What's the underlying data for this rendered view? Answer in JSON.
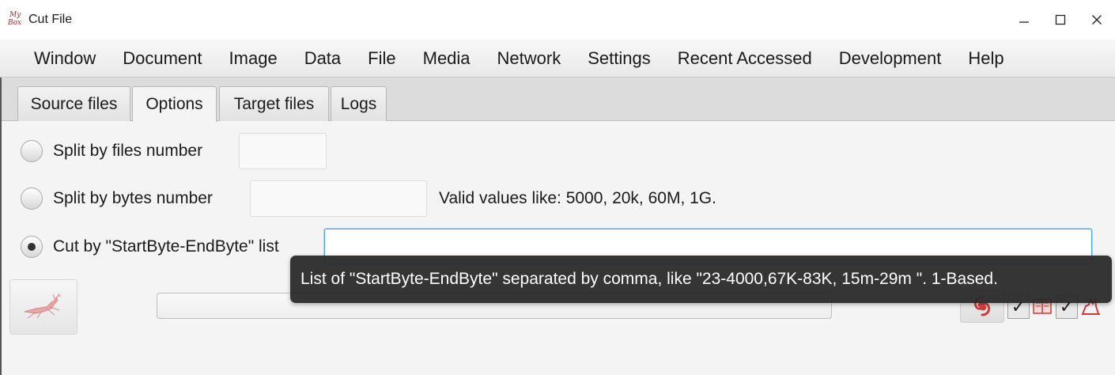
{
  "window": {
    "title": "Cut File",
    "logo_top": "My",
    "logo_bottom": "Box"
  },
  "menu": [
    "Window",
    "Document",
    "Image",
    "Data",
    "File",
    "Media",
    "Network",
    "Settings",
    "Recent Accessed",
    "Development",
    "Help"
  ],
  "tabs": [
    {
      "label": "Source files",
      "active": false
    },
    {
      "label": "Options",
      "active": true
    },
    {
      "label": "Target files",
      "active": false
    },
    {
      "label": "Logs",
      "active": false
    }
  ],
  "options": {
    "split_files": {
      "label": "Split by files number",
      "value": "",
      "selected": false
    },
    "split_bytes": {
      "label": "Split by bytes number",
      "value": "",
      "selected": false,
      "hint": "Valid values like: 5000, 20k, 60M, 1G."
    },
    "cut_list": {
      "label": "Cut by \"StartByte-EndByte\" list",
      "value": "",
      "selected": true
    }
  },
  "tooltip": "List of \"StartByte-EndByte\" separated by comma, like \"23-4000,67K-83K, 15m-29m \". 1-Based.",
  "progress": 0,
  "icons": {
    "start": "running-deer-icon",
    "tool": "netease-logo-icon",
    "book": "book-icon",
    "cat": "cat-icon"
  },
  "colors": {
    "accent_red": "#d23b3b",
    "focus_blue": "#4aa3df",
    "tooltip_bg": "#282828"
  }
}
